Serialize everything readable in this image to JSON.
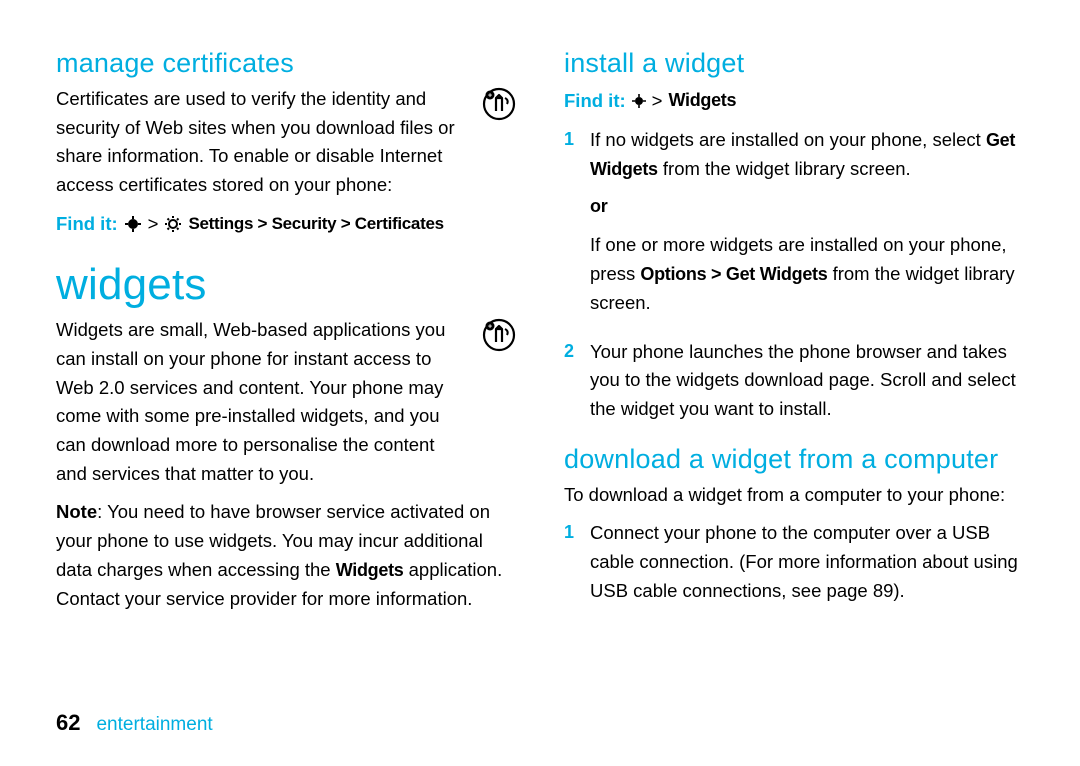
{
  "left": {
    "h_manage": "manage certificates",
    "p_manage": "Certificates are used to verify the identity and security of Web sites when you download files or share information. To enable or disable Internet access certificates stored on your phone:",
    "find_label": "Find it:",
    "find_gt": ">",
    "find_path": "Settings > Security > Certificates",
    "h_widgets": "widgets",
    "p_widgets": "Widgets are small, Web-based applications you can install on your phone for instant access to Web 2.0 services and content. Your phone may come with some pre-installed widgets, and you can download more to personalise the content and services that matter to you.",
    "note_prefix": "Note",
    "note_body": ": You need to have browser service activated on your phone to use widgets. You may incur additional data charges when accessing the ",
    "note_bold": "Widgets",
    "note_tail": " application. Contact your service provider for more information."
  },
  "right": {
    "h_install": "install a widget",
    "find_label": "Find it:",
    "find_gt": ">",
    "find_dest": "Widgets",
    "step1_num": "1",
    "step1_a": "If no widgets are installed on your phone, select ",
    "step1_b_bold": "Get Widgets",
    "step1_c": " from the widget library screen.",
    "or": "or",
    "step1_d": "If one or more widgets are installed on your phone, press ",
    "step1_e_bold": "Options > Get Widgets",
    "step1_f": " from the widget library screen.",
    "step2_num": "2",
    "step2": "Your phone launches the phone browser and takes you to the widgets download page. Scroll and select the widget you want to install.",
    "h_download": "download a widget from a computer",
    "p_download": "To download a widget from a computer to your phone:",
    "d_step1_num": "1",
    "d_step1": "Connect your phone to the computer over a USB cable connection. (For more information about using USB cable connections, see page 89)."
  },
  "footer": {
    "page": "62",
    "section": "entertainment"
  }
}
